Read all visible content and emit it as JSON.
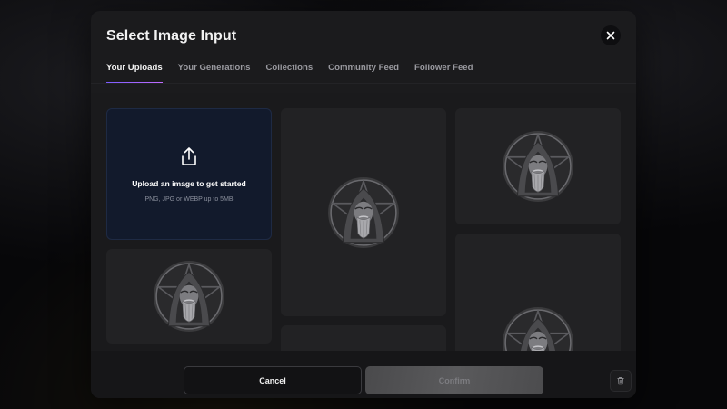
{
  "modal": {
    "title": "Select Image Input",
    "close_icon": "close-icon"
  },
  "tabs": [
    {
      "label": "Your Uploads",
      "active": true
    },
    {
      "label": "Your Generations",
      "active": false
    },
    {
      "label": "Collections",
      "active": false
    },
    {
      "label": "Community Feed",
      "active": false
    },
    {
      "label": "Follower Feed",
      "active": false
    }
  ],
  "upload": {
    "icon": "share-upload-icon",
    "title": "Upload an image to get started",
    "subtitle": "PNG, JPG or WEBP up to 5MB"
  },
  "images": [
    {
      "icon": "wizard-portrait-image"
    },
    {
      "icon": "wizard-portrait-image"
    },
    {
      "icon": "wizard-portrait-image"
    },
    {
      "icon": "wizard-portrait-image"
    },
    {
      "icon": "wizard-portrait-image"
    }
  ],
  "footer": {
    "cancel_label": "Cancel",
    "confirm_label": "Confirm",
    "trash_icon": "trash-icon"
  },
  "colors": {
    "accent_start": "#7c5cff",
    "accent_end": "#c06cff",
    "modal_bg": "#1b1b1d",
    "upload_bg": "#121a2c"
  }
}
